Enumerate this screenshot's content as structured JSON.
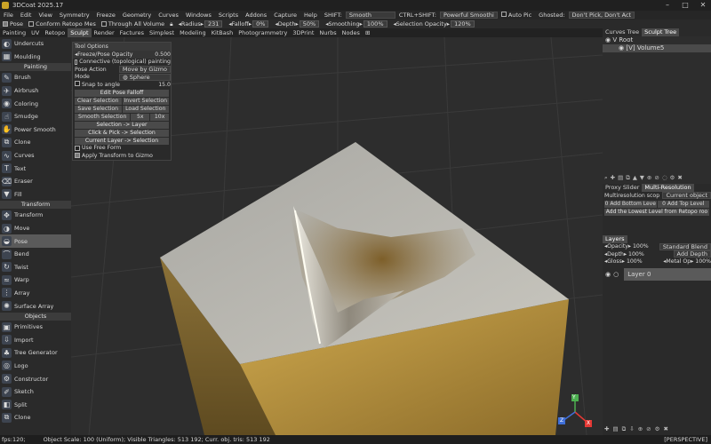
{
  "window": {
    "title": "3DCoat 2025.17"
  },
  "menu": {
    "items": [
      "File",
      "Edit",
      "View",
      "Symmetry",
      "Freeze",
      "Geometry",
      "Curves",
      "Windows",
      "Scripts",
      "Addons",
      "Capture",
      "Help"
    ],
    "shift_label": "SHIFT:",
    "shift_value": "Smooth",
    "ctrl_shift_label": "CTRL+SHIFT:",
    "ctrl_shift_value": "Powerful Smoothi",
    "auto_pic": "Auto Pic",
    "ghosted_label": "Ghosted:",
    "ghosted_value": "Don't Pick, Don't Act"
  },
  "toolbar": {
    "pose": "Pose",
    "conform": "Conform Retopo Mes",
    "through": "Through All Volume",
    "radius_label": "Radius",
    "radius_value": "231",
    "falloff_label": "Falloff",
    "falloff_value": "0%",
    "depth_label": "Depth",
    "depth_value": "50%",
    "smoothing_label": "Smoothing",
    "smoothing_value": "100%",
    "sel_opacity_label": "Selection Opacity",
    "sel_opacity_value": "120%"
  },
  "tabs": [
    "Painting",
    "UV",
    "Retopo",
    "Sculpt",
    "Render",
    "Factures",
    "Simplest",
    "Modeling",
    "KitBash",
    "Photogrammetry",
    "3DPrint",
    "Nurbs",
    "Nodes"
  ],
  "active_tab": "Sculpt",
  "tool_groups": [
    {
      "type": "tool",
      "label": "Undercuts",
      "icon": "◐"
    },
    {
      "type": "tool",
      "label": "Moulding",
      "icon": "▦"
    },
    {
      "type": "section",
      "label": "Painting"
    },
    {
      "type": "tool",
      "label": "Brush",
      "icon": "✎"
    },
    {
      "type": "tool",
      "label": "Airbrush",
      "icon": "✈"
    },
    {
      "type": "tool",
      "label": "Coloring",
      "icon": "◉"
    },
    {
      "type": "tool",
      "label": "Smudge",
      "icon": "☝"
    },
    {
      "type": "tool",
      "label": "Power Smooth",
      "icon": "✋"
    },
    {
      "type": "tool",
      "label": "Clone",
      "icon": "⧉"
    },
    {
      "type": "tool",
      "label": "Curves",
      "icon": "∿"
    },
    {
      "type": "tool",
      "label": "Text",
      "icon": "T"
    },
    {
      "type": "tool",
      "label": "Eraser",
      "icon": "⌫"
    },
    {
      "type": "tool",
      "label": "Fill",
      "icon": "▼"
    },
    {
      "type": "section",
      "label": "Transform"
    },
    {
      "type": "tool",
      "label": "Transform",
      "icon": "✥"
    },
    {
      "type": "tool",
      "label": "Move",
      "icon": "◑"
    },
    {
      "type": "tool",
      "label": "Pose",
      "icon": "◒",
      "selected": true
    },
    {
      "type": "tool",
      "label": "Bend",
      "icon": "⌒"
    },
    {
      "type": "tool",
      "label": "Twist",
      "icon": "↻"
    },
    {
      "type": "tool",
      "label": "Warp",
      "icon": "≈"
    },
    {
      "type": "tool",
      "label": "Array",
      "icon": "⋮"
    },
    {
      "type": "tool",
      "label": "Surface Array",
      "icon": "✺"
    },
    {
      "type": "section",
      "label": "Objects"
    },
    {
      "type": "tool",
      "label": "Primitives",
      "icon": "▣"
    },
    {
      "type": "tool",
      "label": "Import",
      "icon": "⇩"
    },
    {
      "type": "tool",
      "label": "Tree Generator",
      "icon": "♣"
    },
    {
      "type": "tool",
      "label": "Logo",
      "icon": "◎"
    },
    {
      "type": "tool",
      "label": "Constructor",
      "icon": "⚙"
    },
    {
      "type": "tool",
      "label": "Sketch",
      "icon": "✐"
    },
    {
      "type": "tool",
      "label": "Split",
      "icon": "◧"
    },
    {
      "type": "tool",
      "label": "Clone",
      "icon": "⧉"
    }
  ],
  "tool_options": {
    "header": "Tool Options",
    "freeze_label": "Freeze/Pose Opacity",
    "freeze_value": "0.500",
    "connective": "Connective (topological) painting",
    "pose_action_label": "Pose Action",
    "pose_action_value": "Move by Gizmo",
    "mode_label": "Mode",
    "mode_value": "Sphere",
    "snap_label": "Snap to angle",
    "snap_value": "15.0",
    "edit_falloff": "Edit Pose Falloff",
    "clear_selection": "Clear Selection",
    "invert_selection": "Invert Selection",
    "save_selection": "Save Selection",
    "load_selection": "Load Selection",
    "smooth_selection": "Smooth Selection",
    "x5": "5x",
    "x10": "10x",
    "selection_to_layer": "Selection -> Layer",
    "click_pick": "Click & Pick -> Selection",
    "current_layer": "Current Layer -> Selection",
    "use_free_form": "Use Free Form",
    "apply_transform": "Apply Transform to Gizmo"
  },
  "right_panel": {
    "tabs": [
      "Curves Tree",
      "Sculpt Tree"
    ],
    "root": "Root",
    "volume": "Volume5",
    "volume_tag": "[V]",
    "proxy_tabs": [
      "Proxy Slider",
      "Multi-Resolution"
    ],
    "multires_label": "Multiresolution scop",
    "multires_value": "Current object",
    "add_bottom": "Add Bottom Leve",
    "add_top": "Add Top Level",
    "add_lowest": "Add the Lowest Level from Retopo roo",
    "layers_header": "Layers",
    "opacity_label": "Opacity",
    "opacity_value": "100%",
    "blend_value": "Standard Blend",
    "depth_label": "Depth",
    "depth_value": "100%",
    "depth_mode": "Add Depth",
    "gloss_label": "Gloss",
    "gloss_value": "100%",
    "metal_label": "Metal Op",
    "metal_value": "100%",
    "layer_name": "Layer 0"
  },
  "status": {
    "fps": "fps:120;",
    "info": "Object Scale: 100 (Uniform); Visible Triangles: 513 192; Curr. obj. tris: 513 192",
    "view_mode": "[PERSPECTIVE]"
  },
  "gizmo": {
    "x": "X",
    "y": "Y",
    "z": "Z"
  }
}
